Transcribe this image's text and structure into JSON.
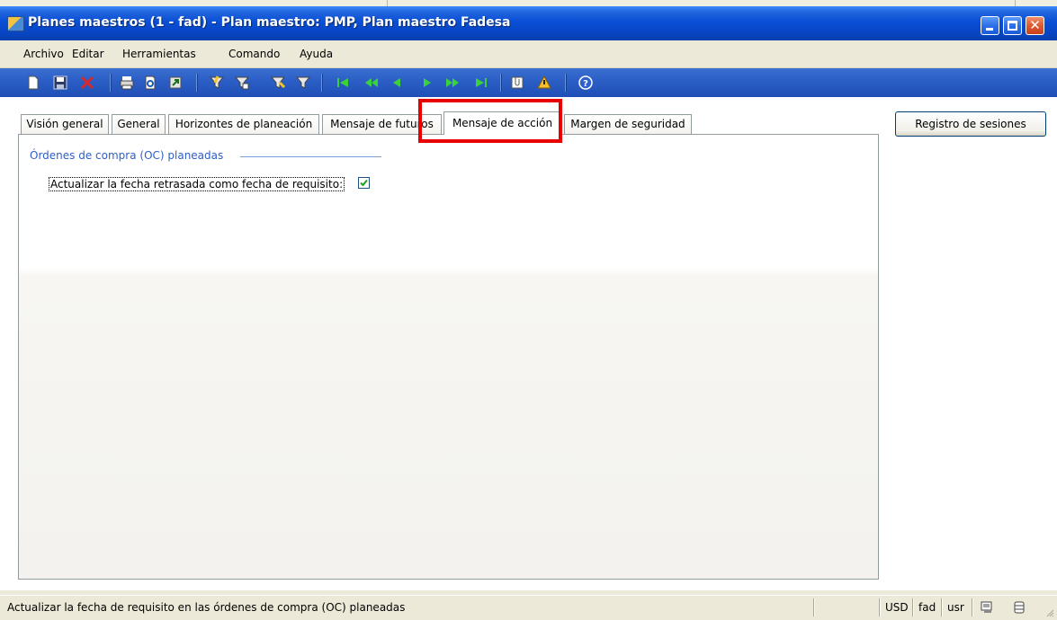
{
  "window": {
    "title": "Planes maestros (1 - fad) - Plan maestro: PMP, Plan maestro Fadesa",
    "app_icon": "dynamics-ax-icon"
  },
  "menu": {
    "items": [
      "Archivo",
      "Editar",
      "Herramientas",
      "Comando",
      "Ayuda"
    ]
  },
  "toolbar": {
    "icons": [
      "new-icon",
      "save-icon",
      "delete-icon",
      "print-icon",
      "print-preview-icon",
      "export-icon",
      "filter-by-selection-icon",
      "filter-by-form-icon",
      "advanced-filter-icon",
      "remove-filter-icon",
      "first-record-icon",
      "previous-page-icon",
      "previous-record-icon",
      "next-record-icon",
      "next-page-icon",
      "last-record-icon",
      "attachments-icon",
      "alerts-icon",
      "help-icon"
    ]
  },
  "tabs": [
    {
      "label": "Visión general"
    },
    {
      "label": "General"
    },
    {
      "label": "Horizontes de planeación"
    },
    {
      "label": "Mensaje de futuros"
    },
    {
      "label": "Mensaje de acción",
      "active": true
    },
    {
      "label": "Margen de seguridad"
    }
  ],
  "panel": {
    "group_title": "Órdenes de compra (OC) planeadas",
    "field_label": "Actualizar la fecha retrasada como fecha de requisito:",
    "field_checked": true
  },
  "side_button": {
    "label": "Registro de sesiones"
  },
  "statusbar": {
    "help_text": "Actualizar la fecha de requisito en las órdenes de compra (OC) planeadas",
    "currency": "USD",
    "company": "fad",
    "layer": "usr"
  },
  "colors": {
    "title_bar": "#0a4fd6",
    "toolbar": "#2a5cc4",
    "group_title": "#2f5ec6",
    "highlight": "#e80000"
  }
}
